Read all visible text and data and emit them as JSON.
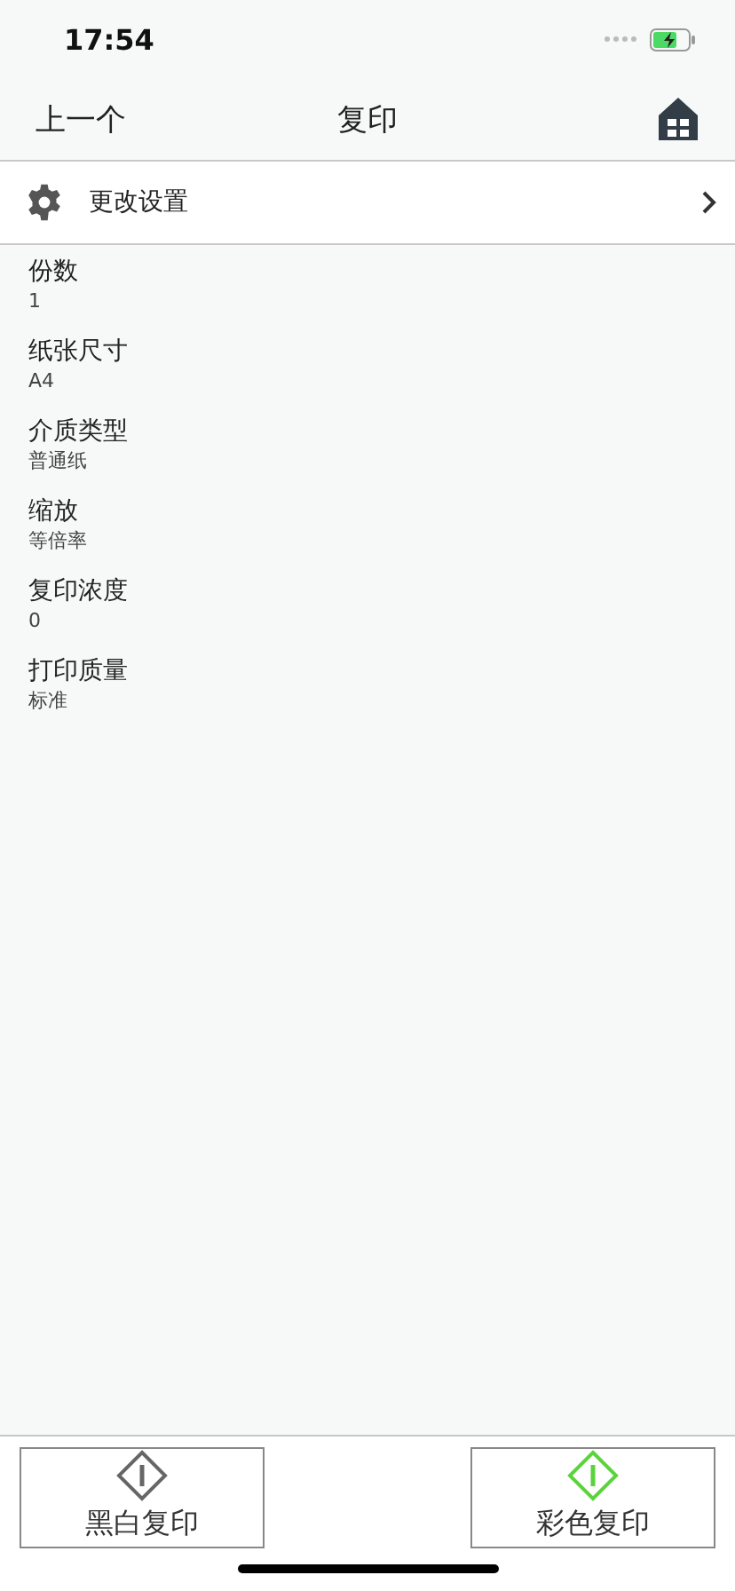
{
  "status_bar": {
    "time": "17:54"
  },
  "nav": {
    "back": "上一个",
    "title": "复印"
  },
  "settings_row": {
    "label": "更改设置"
  },
  "settings": [
    {
      "label": "份数",
      "value": "1"
    },
    {
      "label": "纸张尺寸",
      "value": "A4"
    },
    {
      "label": "介质类型",
      "value": "普通纸"
    },
    {
      "label": "缩放",
      "value": "等倍率"
    },
    {
      "label": "复印浓度",
      "value": "0"
    },
    {
      "label": "打印质量",
      "value": "标准"
    }
  ],
  "buttons": [
    {
      "label": "黑白复印",
      "kind": "mono"
    },
    {
      "label": "彩色复印",
      "kind": "color"
    }
  ]
}
